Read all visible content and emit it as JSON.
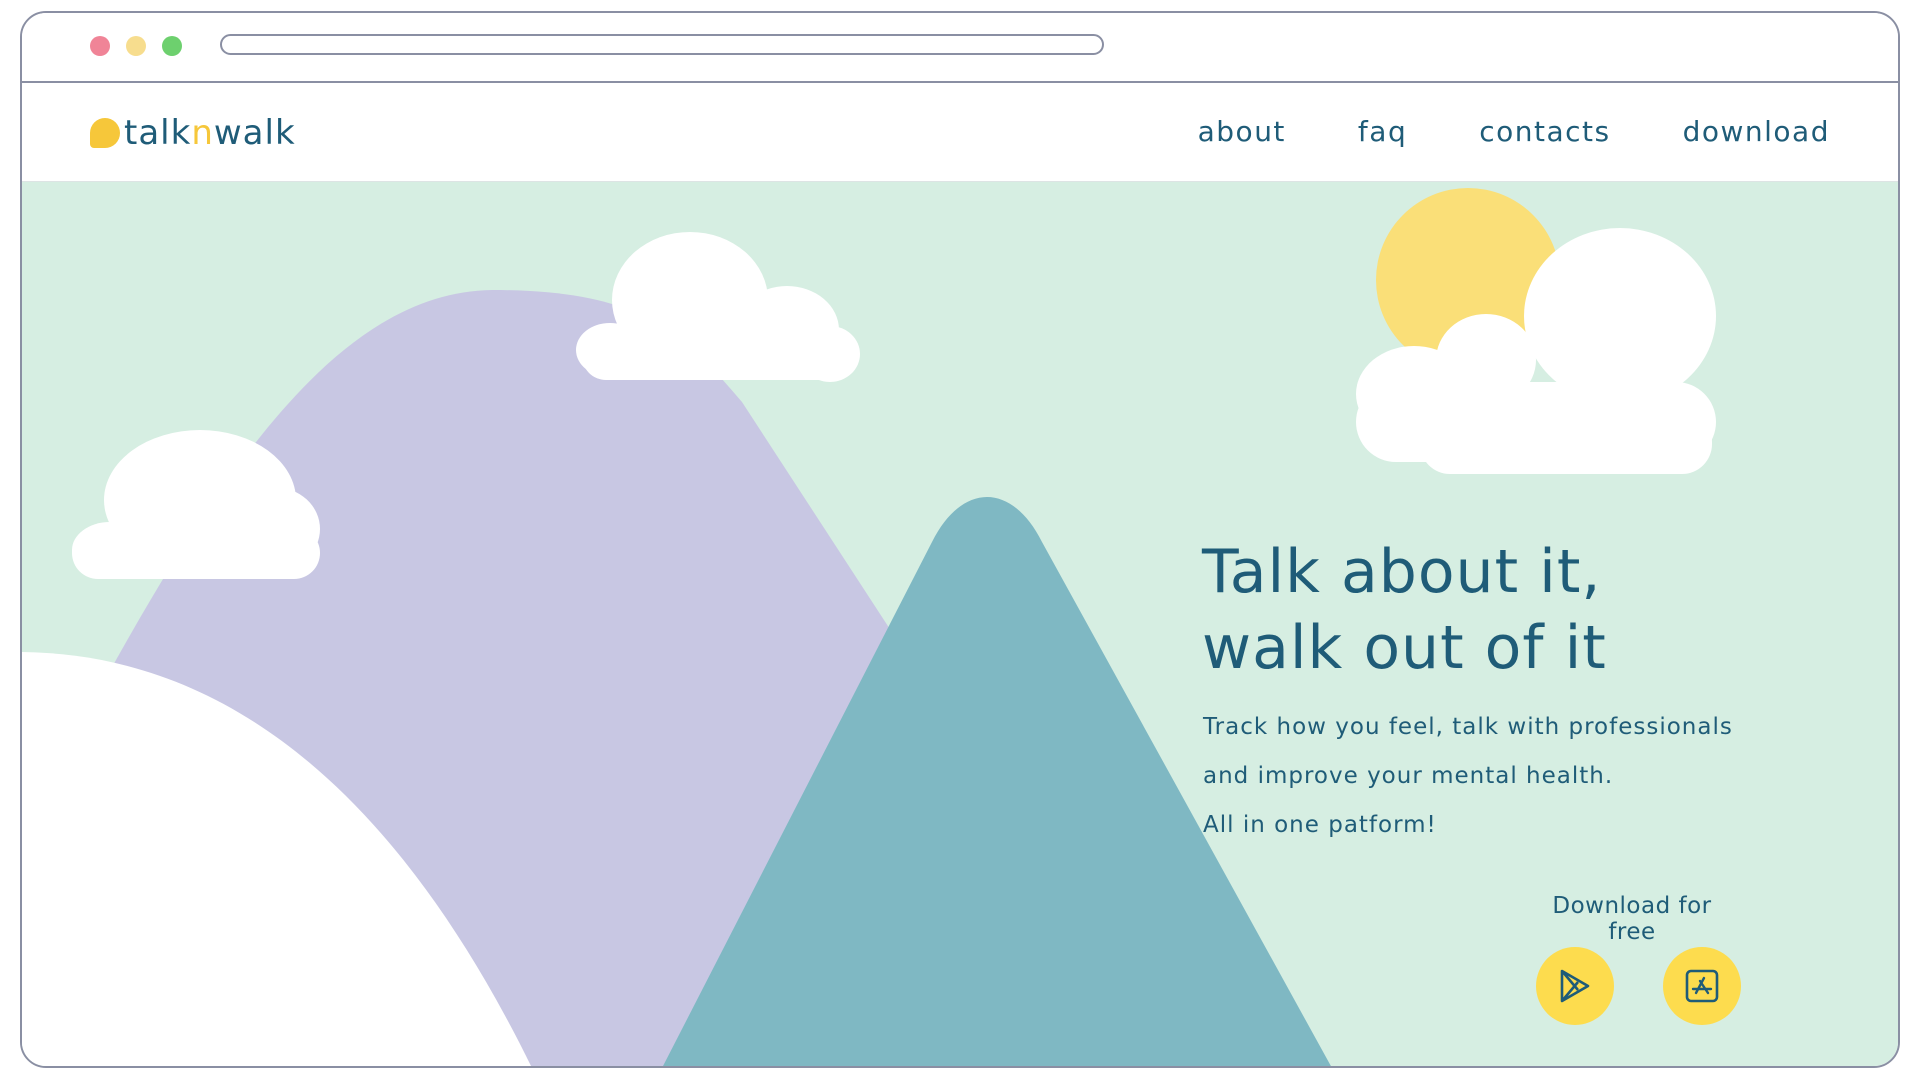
{
  "colors": {
    "frame": "#8a8fa3",
    "dot_red": "#f08497",
    "dot_yellow": "#f7dd8e",
    "dot_green": "#6dd06e",
    "brand_dark": "#1f5c78",
    "brand_yellow": "#f6c73a",
    "hero_bg": "#d6eee2",
    "mountain_purple": "#c8c7e3",
    "mountain_teal": "#7fb8c3",
    "hill_white": "#ffffff",
    "sun": "#fadf78",
    "cloud": "#ffffff",
    "store_button": "#fddc4e"
  },
  "logo": {
    "part1": "talk",
    "part2": "n",
    "part3": "walk"
  },
  "nav": {
    "items": [
      "about",
      "faq",
      "contacts",
      "download"
    ]
  },
  "hero": {
    "headline": [
      "Talk about it,",
      "walk out of it"
    ],
    "tagline": [
      "Track how you feel, talk with professionals",
      "and improve your mental health.",
      "All in one patform!"
    ],
    "download_label": "Download for free",
    "store_icons": [
      "play-store-icon",
      "app-store-icon"
    ]
  }
}
